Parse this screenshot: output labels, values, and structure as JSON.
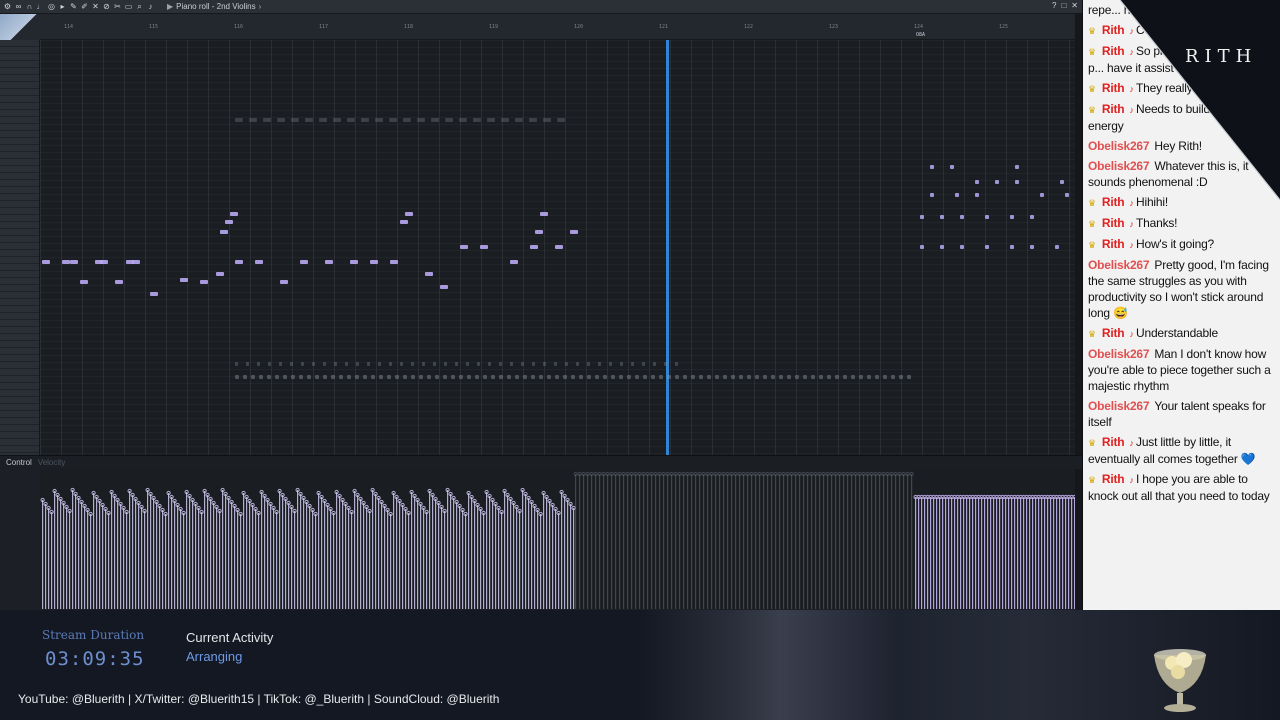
{
  "toolbar": {
    "title": "Piano roll - 2nd Violins",
    "icons": [
      "tool-icon",
      "link-icon",
      "magnet-icon",
      "metronome-icon",
      "snap-icon",
      "play-icon",
      "pencil-icon",
      "paint-icon",
      "delete-icon",
      "mute-icon",
      "slice-icon",
      "select-icon",
      "zoom-icon",
      "speaker-icon"
    ],
    "window_controls": [
      "?",
      "□",
      "✕"
    ]
  },
  "ruler": {
    "bars": [
      "114",
      "115",
      "116",
      "117",
      "118",
      "119",
      "120",
      "121",
      "122",
      "123",
      "124",
      "125"
    ],
    "marker_label": "O8A"
  },
  "control": {
    "label": "Control",
    "sub": "Velocity"
  },
  "chat": [
    {
      "user": "",
      "crown": false,
      "text": "repe... have t... complete..."
    },
    {
      "user": "Rith",
      "crown": true,
      "text": "Co..."
    },
    {
      "user": "Rith",
      "crown": true,
      "text": "So pla... piccolo's previous p... have it assist the trump..."
    },
    {
      "user": "Rith",
      "crown": true,
      "text": "They really don't help 🤣"
    },
    {
      "user": "Rith",
      "crown": true,
      "text": "Needs to build more energy"
    },
    {
      "user": "Obelisk267",
      "crown": false,
      "text": "Hey Rith!"
    },
    {
      "user": "Obelisk267",
      "crown": false,
      "text": "Whatever this is, it sounds phenomenal :D"
    },
    {
      "user": "Rith",
      "crown": true,
      "text": "Hihihi!"
    },
    {
      "user": "Rith",
      "crown": true,
      "text": "Thanks!"
    },
    {
      "user": "Rith",
      "crown": true,
      "text": "How's it going?"
    },
    {
      "user": "Obelisk267",
      "crown": false,
      "text": "Pretty good, I'm facing the same struggles as you with productivity so I won't stick around long 😅"
    },
    {
      "user": "Rith",
      "crown": true,
      "text": "Understandable"
    },
    {
      "user": "Obelisk267",
      "crown": false,
      "text": "Man I don't know how you're able to piece together such a majestic rhythm"
    },
    {
      "user": "Obelisk267",
      "crown": false,
      "text": "Your talent speaks for itself"
    },
    {
      "user": "Rith",
      "crown": true,
      "text": "Just little by little, it eventually all comes together 💙"
    },
    {
      "user": "Rith",
      "crown": true,
      "text": "I hope you are able to knock out all that you need to today"
    }
  ],
  "colors": {
    "rith": "#e02020",
    "obelisk": "#e05050",
    "note": "#b9a8f2",
    "playhead": "#2e86d6",
    "velocity": "#cfc7ef"
  },
  "banner": {
    "text": "RITH"
  },
  "bottom": {
    "stream_duration_label": "Stream Duration",
    "stream_duration_value": "03:09:35",
    "activity_label": "Current Activity",
    "activity_value": "Arranging",
    "socials": "YouTube: @Bluerith | X/Twitter: @Bluerith15 | TikTok: @_Bluerith | SoundCloud: @Bluerith"
  }
}
